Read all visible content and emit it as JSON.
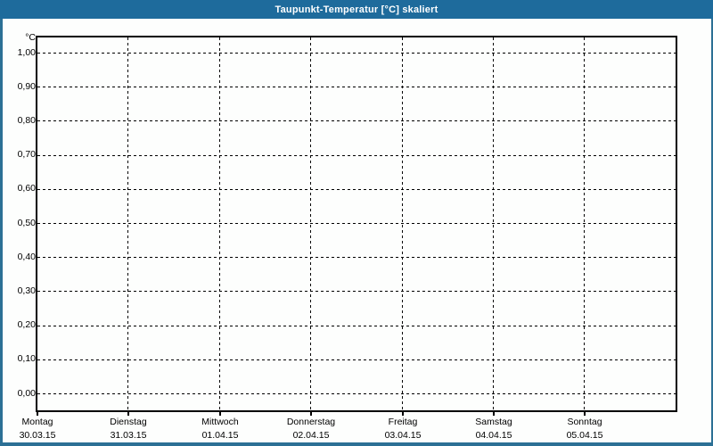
{
  "window": {
    "title": "Taupunkt-Temperatur [°C] skaliert"
  },
  "colors": {
    "title_bar": "#1e6b9c",
    "window_border": "#2c7095",
    "title_text": "#ffffff",
    "background": "#fdfefd",
    "plot_border": "#000000",
    "gridline": "#000000",
    "label_text": "#000000"
  },
  "chart_data": {
    "type": "line",
    "title": "Taupunkt-Temperatur [°C] skaliert",
    "ylabel": "°C",
    "y_axis": {
      "unit_label": "°C",
      "tick_labels": [
        "1,00",
        "0,90",
        "0,80",
        "0,70",
        "0,60",
        "0,50",
        "0,40",
        "0,30",
        "0,20",
        "0,10",
        "0,00"
      ],
      "tick_values": [
        1.0,
        0.9,
        0.8,
        0.7,
        0.6,
        0.5,
        0.4,
        0.3,
        0.2,
        0.1,
        0.0
      ],
      "ylim": [
        -0.05,
        1.05
      ],
      "grid": "dashed"
    },
    "x_axis": {
      "tick_days": [
        "Montag",
        "Dienstag",
        "Mittwoch",
        "Donnerstag",
        "Freitag",
        "Samstag",
        "Sonntag"
      ],
      "tick_dates": [
        "30.03.15",
        "31.03.15",
        "01.04.15",
        "02.04.15",
        "03.04.15",
        "04.04.15",
        "05.04.15"
      ],
      "grid": "dashed"
    },
    "series": [],
    "legend": "none"
  }
}
